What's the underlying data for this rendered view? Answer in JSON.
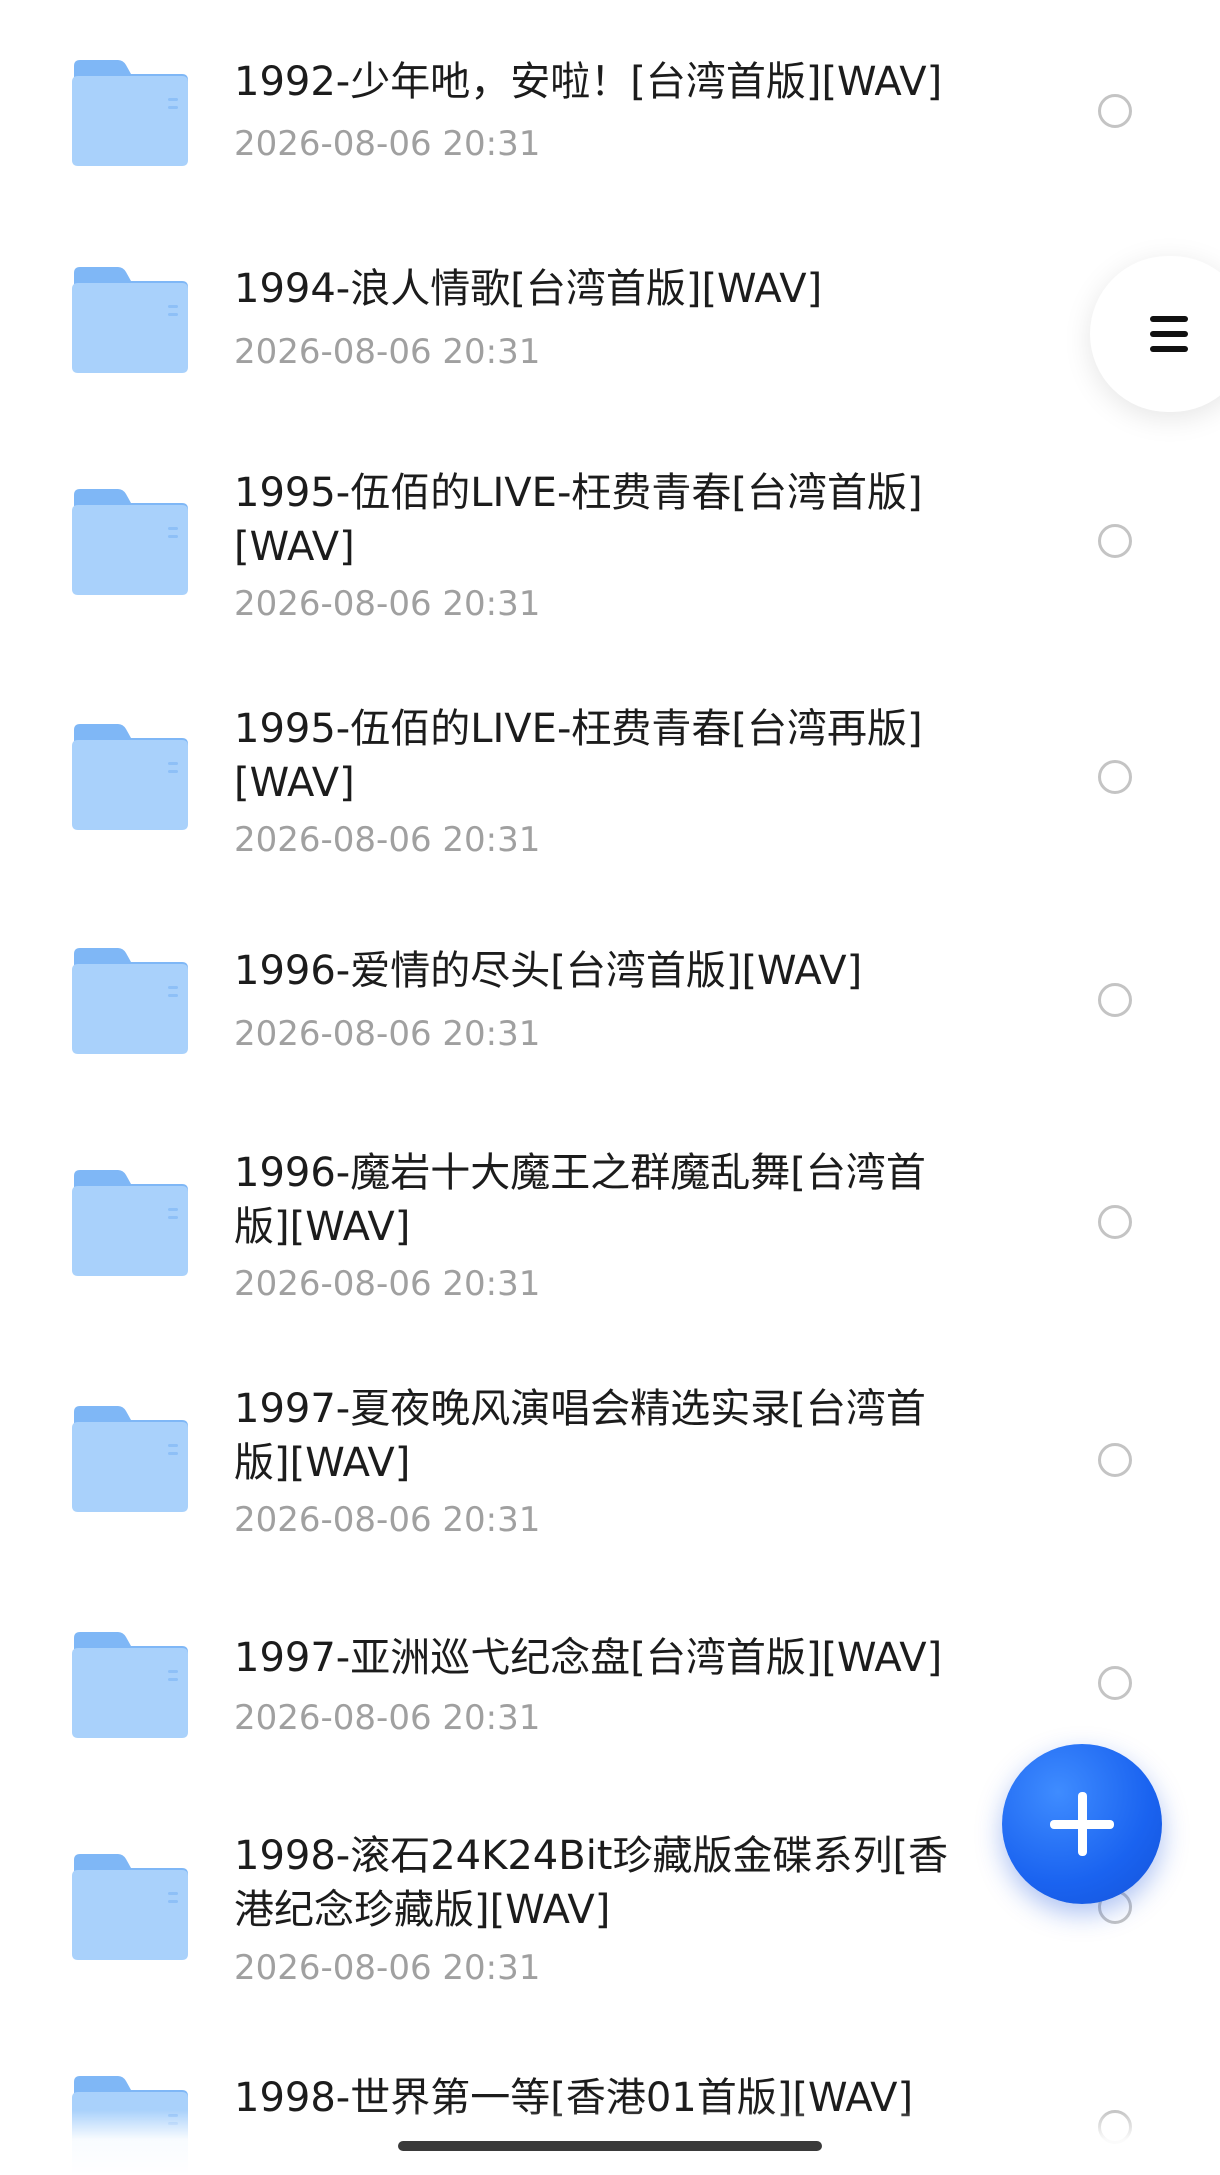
{
  "folders": [
    {
      "name": "1992-少年吔，安啦！[台湾首版][WAV]",
      "date": "2026-08-06 20:31"
    },
    {
      "name": "1994-浪人情歌[台湾首版][WAV]",
      "date": "2026-08-06 20:31"
    },
    {
      "name": "1995-伍佰的LIVE-枉费青春[台湾首版][WAV]",
      "date": "2026-08-06 20:31"
    },
    {
      "name": "1995-伍佰的LIVE-枉费青春[台湾再版][WAV]",
      "date": "2026-08-06 20:31"
    },
    {
      "name": "1996-爱情的尽头[台湾首版][WAV]",
      "date": "2026-08-06 20:31"
    },
    {
      "name": "1996-魔岩十大魔王之群魔乱舞[台湾首版][WAV]",
      "date": "2026-08-06 20:31"
    },
    {
      "name": "1997-夏夜晚风演唱会精选实录[台湾首版][WAV]",
      "date": "2026-08-06 20:31"
    },
    {
      "name": "1997-亚洲巡弋纪念盘[台湾首版][WAV]",
      "date": "2026-08-06 20:31"
    },
    {
      "name": "1998-滚石24K24Bit珍藏版金碟系列[香港纪念珍藏版][WAV]",
      "date": "2026-08-06 20:31"
    },
    {
      "name": "1998-世界第一等[香港01首版][WAV]",
      "date": ""
    }
  ],
  "icons": {
    "folder": "folder-icon",
    "menu": "menu-icon",
    "fab": "plus-icon"
  },
  "colors": {
    "folder_light": "#a9d1fb",
    "folder_dark": "#7fb7f6",
    "fab": "#1a63f0",
    "title_text": "#1c1c1c",
    "date_text": "#a0a0a0"
  }
}
